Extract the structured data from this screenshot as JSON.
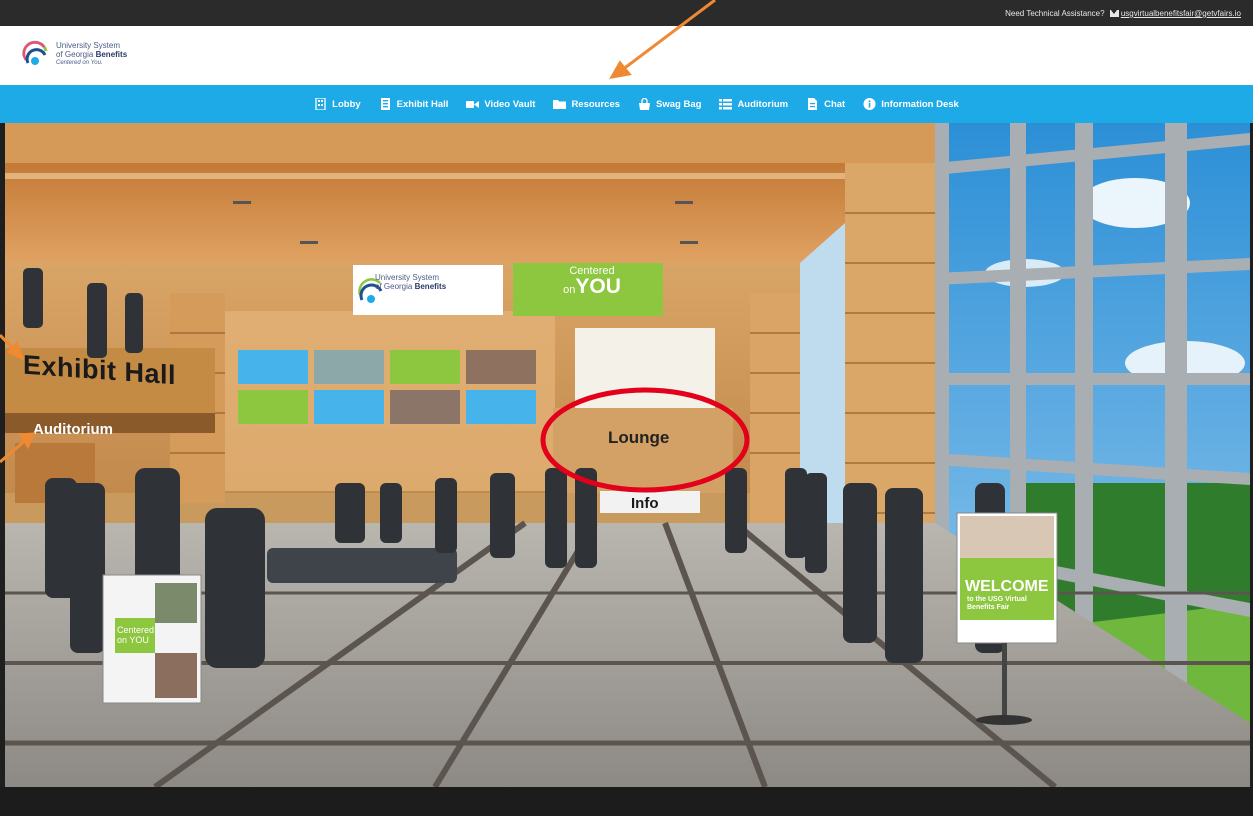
{
  "topbar": {
    "support_text": "Need Technical Assistance?",
    "support_email": "usgvirtualbenefitsfair@getvfairs.io",
    "mail_icon": "envelope-icon"
  },
  "header": {
    "logo_line1": "University System",
    "logo_line2a": "of Georgia ",
    "logo_line2b": "Benefits",
    "logo_line3": "Centered on You."
  },
  "nav": {
    "items": [
      {
        "label": "Lobby",
        "icon": "building-icon"
      },
      {
        "label": "Exhibit Hall",
        "icon": "booth-icon"
      },
      {
        "label": "Video Vault",
        "icon": "video-camera-icon"
      },
      {
        "label": "Resources",
        "icon": "folder-icon"
      },
      {
        "label": "Swag Bag",
        "icon": "bag-icon"
      },
      {
        "label": "Auditorium",
        "icon": "grid-list-icon"
      },
      {
        "label": "Chat",
        "icon": "document-chat-icon"
      },
      {
        "label": "Information Desk",
        "icon": "info-circle-icon"
      }
    ]
  },
  "scene": {
    "exhibit_hall": "Exhibit Hall",
    "auditorium": "Auditorium",
    "lounge": "Lounge",
    "info": "Info",
    "centered_small": "Centered",
    "centered_on": "on",
    "centered_you": "YOU",
    "banner_line1": "University System",
    "banner_line2a": "of Georgia ",
    "banner_line2b": "Benefits",
    "sign_welcome": "WELCOME",
    "sign_sub_line1": "to the USG Virtual",
    "sign_sub_line2": "Benefits Fair",
    "sign2_line1": "Centered",
    "sign2_line2": "on YOU"
  },
  "colors": {
    "nav_bg": "#1daae6",
    "topbar_bg": "#2b2b2b",
    "highlight_circle": "#e3001b",
    "arrow": "#ef8a32",
    "green_panel": "#8dc63f",
    "blue_panel": "#46b4ea"
  }
}
